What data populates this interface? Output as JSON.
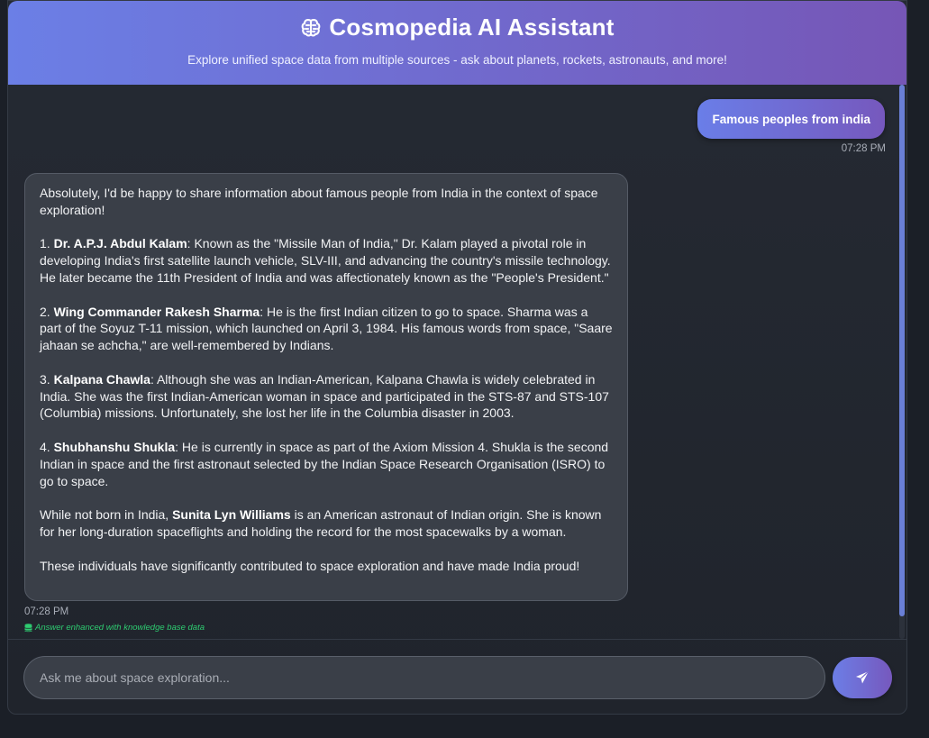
{
  "header": {
    "brain_icon": "brain-icon",
    "title": "Cosmopedia AI Assistant",
    "subtitle": "Explore unified space data from multiple sources - ask about planets, rockets, astronauts, and more!"
  },
  "messages": {
    "user": {
      "text": "Famous peoples from india",
      "time": "07:28 PM"
    },
    "assistant": {
      "intro": "Absolutely, I'd be happy to share information about famous people from India in the context of space exploration!",
      "items": [
        {
          "num": "1. ",
          "name": "Dr. A.P.J. Abdul Kalam",
          "text": ": Known as the \"Missile Man of India,\" Dr. Kalam played a pivotal role in developing India's first satellite launch vehicle, SLV-III, and advancing the country's missile technology. He later became the 11th President of India and was affectionately known as the \"People's President.\""
        },
        {
          "num": "2. ",
          "name": "Wing Commander Rakesh Sharma",
          "text": ": He is the first Indian citizen to go to space. Sharma was a part of the Soyuz T-11 mission, which launched on April 3, 1984. His famous words from space, \"Saare jahaan se achcha,\" are well-remembered by Indians."
        },
        {
          "num": "3. ",
          "name": "Kalpana Chawla",
          "text": ": Although she was an Indian-American, Kalpana Chawla is widely celebrated in India. She was the first Indian-American woman in space and participated in the STS-87 and STS-107 (Columbia) missions. Unfortunately, she lost her life in the Columbia disaster in 2003."
        },
        {
          "num": "4. ",
          "name": "Shubhanshu Shukla",
          "text": ": He is currently in space as part of the Axiom Mission 4. Shukla is the second Indian in space and the first astronaut selected by the Indian Space Research Organisation (ISRO) to go to space."
        }
      ],
      "extra_prefix": "While not born in India, ",
      "extra_name": "Sunita Lyn Williams",
      "extra_text": " is an American astronaut of Indian origin. She is known for her long-duration spaceflights and holding the record for the most spacewalks by a woman.",
      "closing": "These individuals have significantly contributed to space exploration and have made India proud!",
      "time": "07:28 PM",
      "kb_note": "Answer enhanced with knowledge base data",
      "kb_icon": "database-icon"
    }
  },
  "input": {
    "placeholder": "Ask me about space exploration...",
    "value": ""
  },
  "send_button": {
    "icon": "send-icon"
  },
  "colors": {
    "accent_start": "#6b7fe6",
    "accent_end": "#7656b6",
    "kb_green": "#2ecc71",
    "background": "#1b1f27"
  }
}
